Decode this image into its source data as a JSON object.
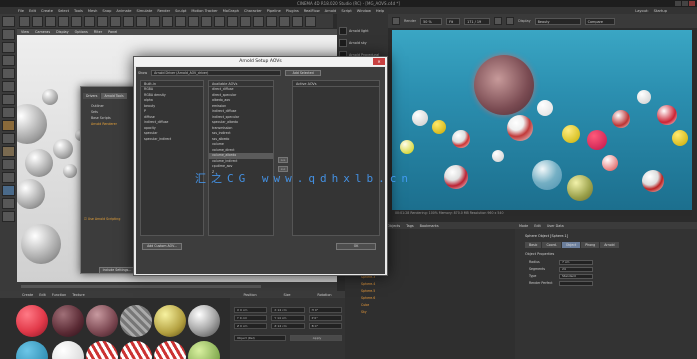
{
  "window": {
    "title": "CINEMA 4D R18.020 Studio (RC) - [MG_AOVS.c4d *]"
  },
  "menu": [
    "File",
    "Edit",
    "Create",
    "Select",
    "Tools",
    "Mesh",
    "Snap",
    "Animate",
    "Simulate",
    "Render",
    "Sculpt",
    "Motion Tracker",
    "MoGraph",
    "Character",
    "Pipeline",
    "Plugins",
    "RealFlow",
    "Arnold",
    "Script",
    "Window",
    "Help"
  ],
  "layout_label": "Layout:",
  "layout_value": "Startup",
  "viewport_menu": [
    "View",
    "Cameras",
    "Display",
    "Options",
    "Filter",
    "Panel"
  ],
  "right_panel": {
    "items": [
      "Arnold light",
      "Arnold sky",
      "Arnold Procedural"
    ]
  },
  "render_bar": {
    "render_label": "Render",
    "zoom": "50 %",
    "fit": "Fit",
    "frame": "171 / 19",
    "display_label": "Display",
    "display_value": "Beauty",
    "compare": "Compare"
  },
  "render_status": "00:01:28  Rendering: 100%  Memory: 870.0 MB  Resolution 960 x 540",
  "dialog_back": {
    "tabs": [
      "Drivers",
      "Arnold Tools"
    ],
    "items": [
      "Outliner",
      "Sets",
      "Base Scripts",
      "Arnold Renderer"
    ],
    "checkbox_label": "Use Arnold Scripting",
    "button": "Include Settings..."
  },
  "dialog": {
    "title": "Arnold Setup AOVs",
    "filter_label": "Show",
    "filter_value": "Arnold Driver (Arnold_AOV_driver)",
    "filter_button": "Add Selected",
    "columns": {
      "builtin": {
        "header": "Built-in",
        "items": [
          "RGBA",
          "RGBA density",
          "alpha",
          "beauty",
          "P",
          "diffuse",
          "indirect_diffuse",
          "opacity",
          "specular",
          "specular_indirect"
        ]
      },
      "available": {
        "header": "Available AOVs",
        "items": [
          "direct_diffuse",
          "direct_specular",
          "albedo_aov",
          "emission",
          "indirect_diffuse",
          "indirect_specular",
          "specular_albedo",
          "transmission",
          "sss_indirect",
          "sss_albedo",
          "volume",
          "volume_direct",
          "volume_albedo",
          "volume_indirect",
          "cputime_aov",
          "Z"
        ]
      },
      "active": {
        "header": "Active AOVs",
        "items": []
      }
    },
    "arrows": [
      ">>",
      "<<"
    ],
    "bottom_left_button": "Add Custom AOV...",
    "ok_button": "OK"
  },
  "watermark": "汇之CG   www.qdhxlb.cn",
  "object_manager": {
    "header": [
      "File",
      "Edit",
      "View",
      "Objects",
      "Tags",
      "Bookmarks"
    ],
    "rows": [
      "Arnold",
      "Scene",
      "Sphere",
      "Cylinder",
      "Sphere.1",
      "Sphere.2",
      "Sphere.3",
      "Sphere.4",
      "Sphere.5",
      "Sphere.6",
      "Cube",
      "Sky"
    ]
  },
  "attribute_manager": {
    "header": [
      "Mode",
      "Edit",
      "User Data"
    ],
    "object_label": "Sphere Object [Sphere.1]",
    "tabs": [
      "Basic",
      "Coord.",
      "Object",
      "Phong",
      "Arnold"
    ],
    "section": "Object Properties",
    "rows": [
      {
        "label": "Radius",
        "value": "7 cm"
      },
      {
        "label": "Segments",
        "value": "24"
      },
      {
        "label": "Type",
        "value": "Standard"
      },
      {
        "label": "Render Perfect",
        "value": ""
      }
    ]
  },
  "material_panel": {
    "header": [
      "Create",
      "Edit",
      "Function",
      "Texture"
    ]
  },
  "coord_panel": {
    "header": [
      "Position",
      "Size",
      "Rotation"
    ],
    "rows": [
      [
        "X 0 cm",
        "X 14 cm",
        "H 0°"
      ],
      [
        "Y 0 cm",
        "Y 14 cm",
        "P 0°"
      ],
      [
        "Z 0 cm",
        "Z 14 cm",
        "B 0°"
      ]
    ],
    "mode": "Object (Rel)",
    "apply": "Apply"
  }
}
